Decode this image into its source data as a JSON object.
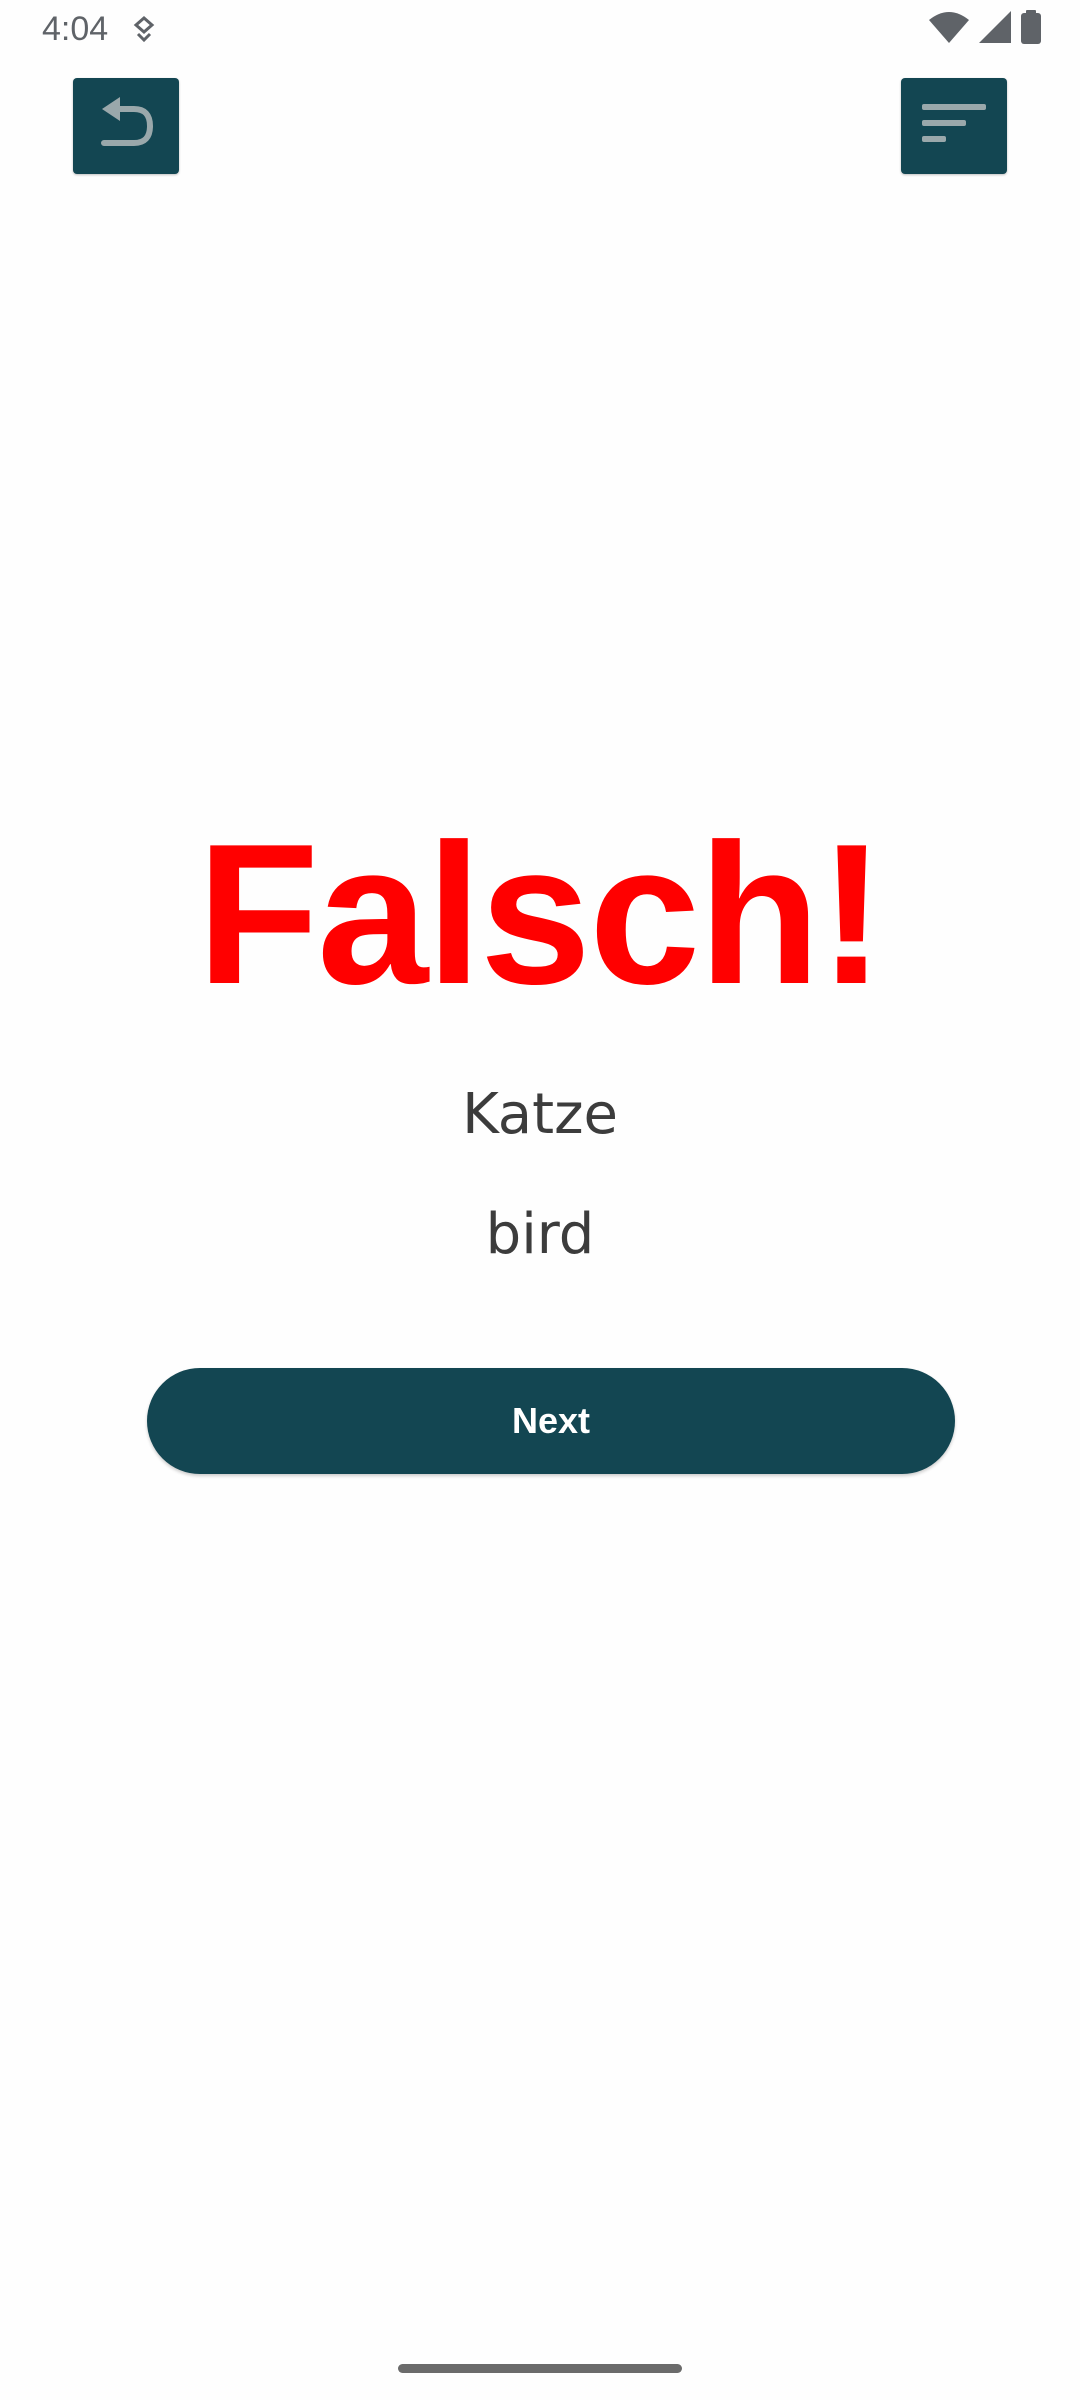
{
  "status_bar": {
    "time": "4:04",
    "icons": [
      "notification-icon",
      "wifi-icon",
      "cellular-signal-icon",
      "battery-icon"
    ]
  },
  "toolbar": {
    "back_icon": "undo-back-icon",
    "menu_icon": "sort-menu-icon"
  },
  "result": {
    "title": "Falsch!",
    "prompt_word": "Katze",
    "given_answer": "bird"
  },
  "actions": {
    "next_label": "Next"
  },
  "colors": {
    "accent": "#134652",
    "error": "#ff0000",
    "text": "#3c3c3c",
    "background": "#fefefe"
  }
}
